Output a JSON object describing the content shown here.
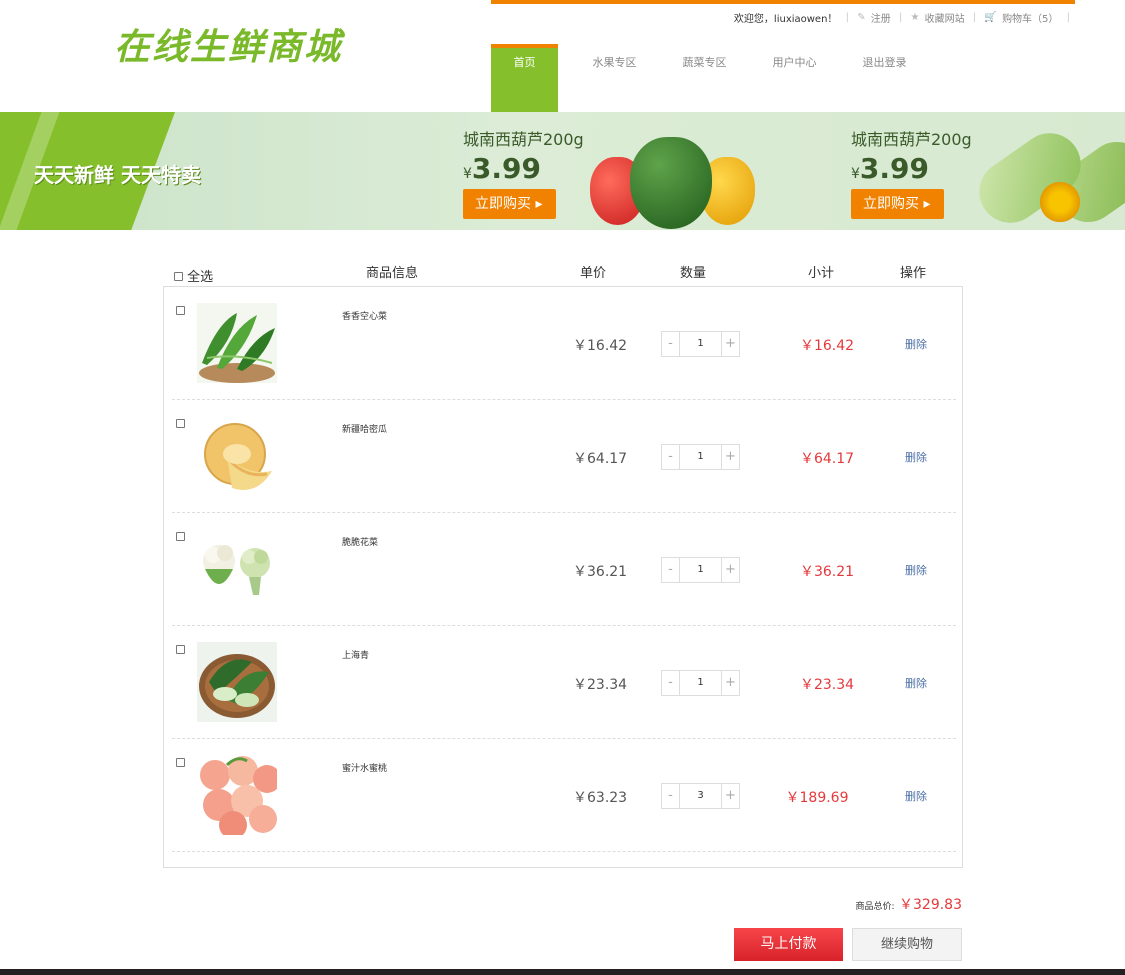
{
  "header": {
    "logo_text": "在线生鲜商城",
    "welcome": "欢迎您，liuxiaowen！",
    "register": "注册",
    "favorite": "收藏网站",
    "cart": "购物车（5）",
    "accent_color": "#f08200",
    "brand_color": "#85c02c"
  },
  "nav": {
    "items": [
      {
        "label": "首页",
        "active": true
      },
      {
        "label": "水果专区"
      },
      {
        "label": "蔬菜专区"
      },
      {
        "label": "用户中心"
      },
      {
        "label": "退出登录"
      }
    ]
  },
  "banner": {
    "slogan": "天天新鲜  天天特卖",
    "promos": [
      {
        "name": "城南西葫芦200g",
        "currency": "¥",
        "price": "3.99",
        "button": "立即购买 ▸"
      },
      {
        "name": "城南西葫芦200g",
        "currency": "¥",
        "price": "3.99",
        "button": "立即购买 ▸"
      }
    ]
  },
  "cart": {
    "headers": {
      "select_all": "全选",
      "info": "商品信息",
      "unit_price": "单价",
      "quantity": "数量",
      "subtotal": "小计",
      "action": "操作"
    },
    "items": [
      {
        "name": "香香空心菜",
        "price": "￥16.42",
        "qty": "1",
        "subtotal": "￥16.42",
        "delete": "删除",
        "image": "water-spinach"
      },
      {
        "name": "新疆哈密瓜",
        "price": "￥64.17",
        "qty": "1",
        "subtotal": "￥64.17",
        "delete": "删除",
        "image": "hami-melon"
      },
      {
        "name": "脆脆花菜",
        "price": "￥36.21",
        "qty": "1",
        "subtotal": "￥36.21",
        "delete": "删除",
        "image": "cauliflower"
      },
      {
        "name": "上海青",
        "price": "￥23.34",
        "qty": "1",
        "subtotal": "￥23.34",
        "delete": "删除",
        "image": "bok-choy"
      },
      {
        "name": "蜜汁水蜜桃",
        "price": "￥63.23",
        "qty": "3",
        "subtotal": "￥189.69",
        "delete": "删除",
        "image": "peaches"
      }
    ],
    "minus": "-",
    "plus": "+",
    "total_label": "商品总价:",
    "total_value": "￥329.83",
    "pay_button": "马上付款",
    "continue_button": "继续购物"
  }
}
